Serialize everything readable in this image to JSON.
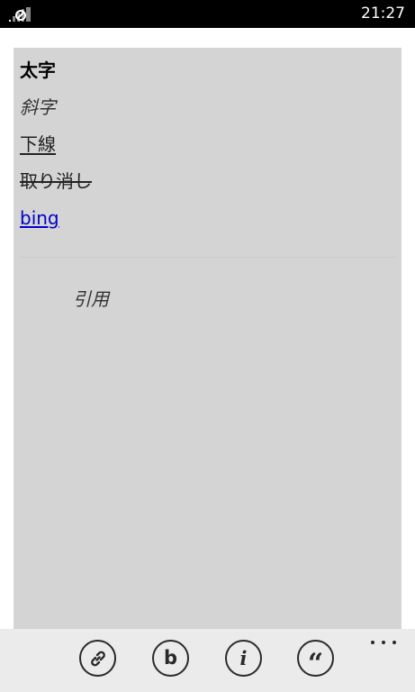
{
  "status_bar": {
    "time": "21:27",
    "signal_icon": "no-signal-icon"
  },
  "editor": {
    "bold": "太字",
    "italic": "斜字",
    "underline": "下線",
    "strikethrough": "取り消し",
    "link": "bing",
    "quote": "引用",
    "background_color": "#d4d4d4",
    "link_color": "#0000cc"
  },
  "app_bar": {
    "buttons": [
      {
        "icon": "link-icon",
        "glyph": ""
      },
      {
        "icon": "bold-icon",
        "glyph": "b"
      },
      {
        "icon": "italic-icon",
        "glyph": "i"
      },
      {
        "icon": "quote-icon",
        "glyph": "“"
      }
    ],
    "more_icon": "ellipsis-icon"
  }
}
